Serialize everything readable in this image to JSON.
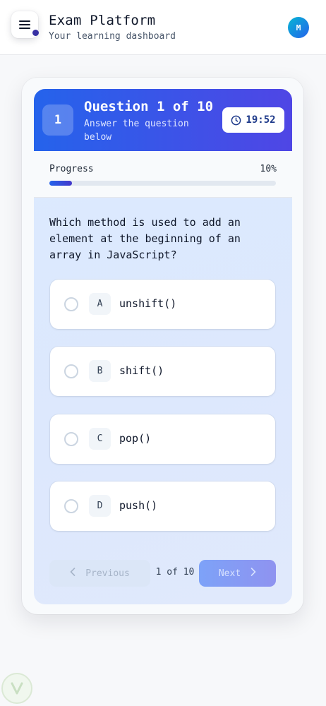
{
  "header": {
    "title": "Exam Platform",
    "subtitle": "Your learning dashboard",
    "avatar_initial": "M",
    "menu_icon": "hamburger-menu-icon"
  },
  "question_card": {
    "number": "1",
    "title": "Question 1 of 10",
    "subtitle": "Answer the question below",
    "timer": "19:52",
    "timer_icon": "clock-icon"
  },
  "progress": {
    "label": "Progress",
    "value_text": "10%",
    "value": 0.1
  },
  "question": {
    "text": "Which method is used to add an element at the beginning of an array in JavaScript?",
    "options": [
      {
        "letter": "A",
        "text": "unshift()"
      },
      {
        "letter": "B",
        "text": "shift()"
      },
      {
        "letter": "C",
        "text": "pop()"
      },
      {
        "letter": "D",
        "text": "push()"
      }
    ]
  },
  "navigation": {
    "previous_label": "Previous",
    "next_label": "Next",
    "page_indicator": "1 of 10"
  },
  "colors": {
    "accent_start": "#2563eb",
    "accent_end": "#4f46e5",
    "card_bg": "#dbeafe"
  }
}
